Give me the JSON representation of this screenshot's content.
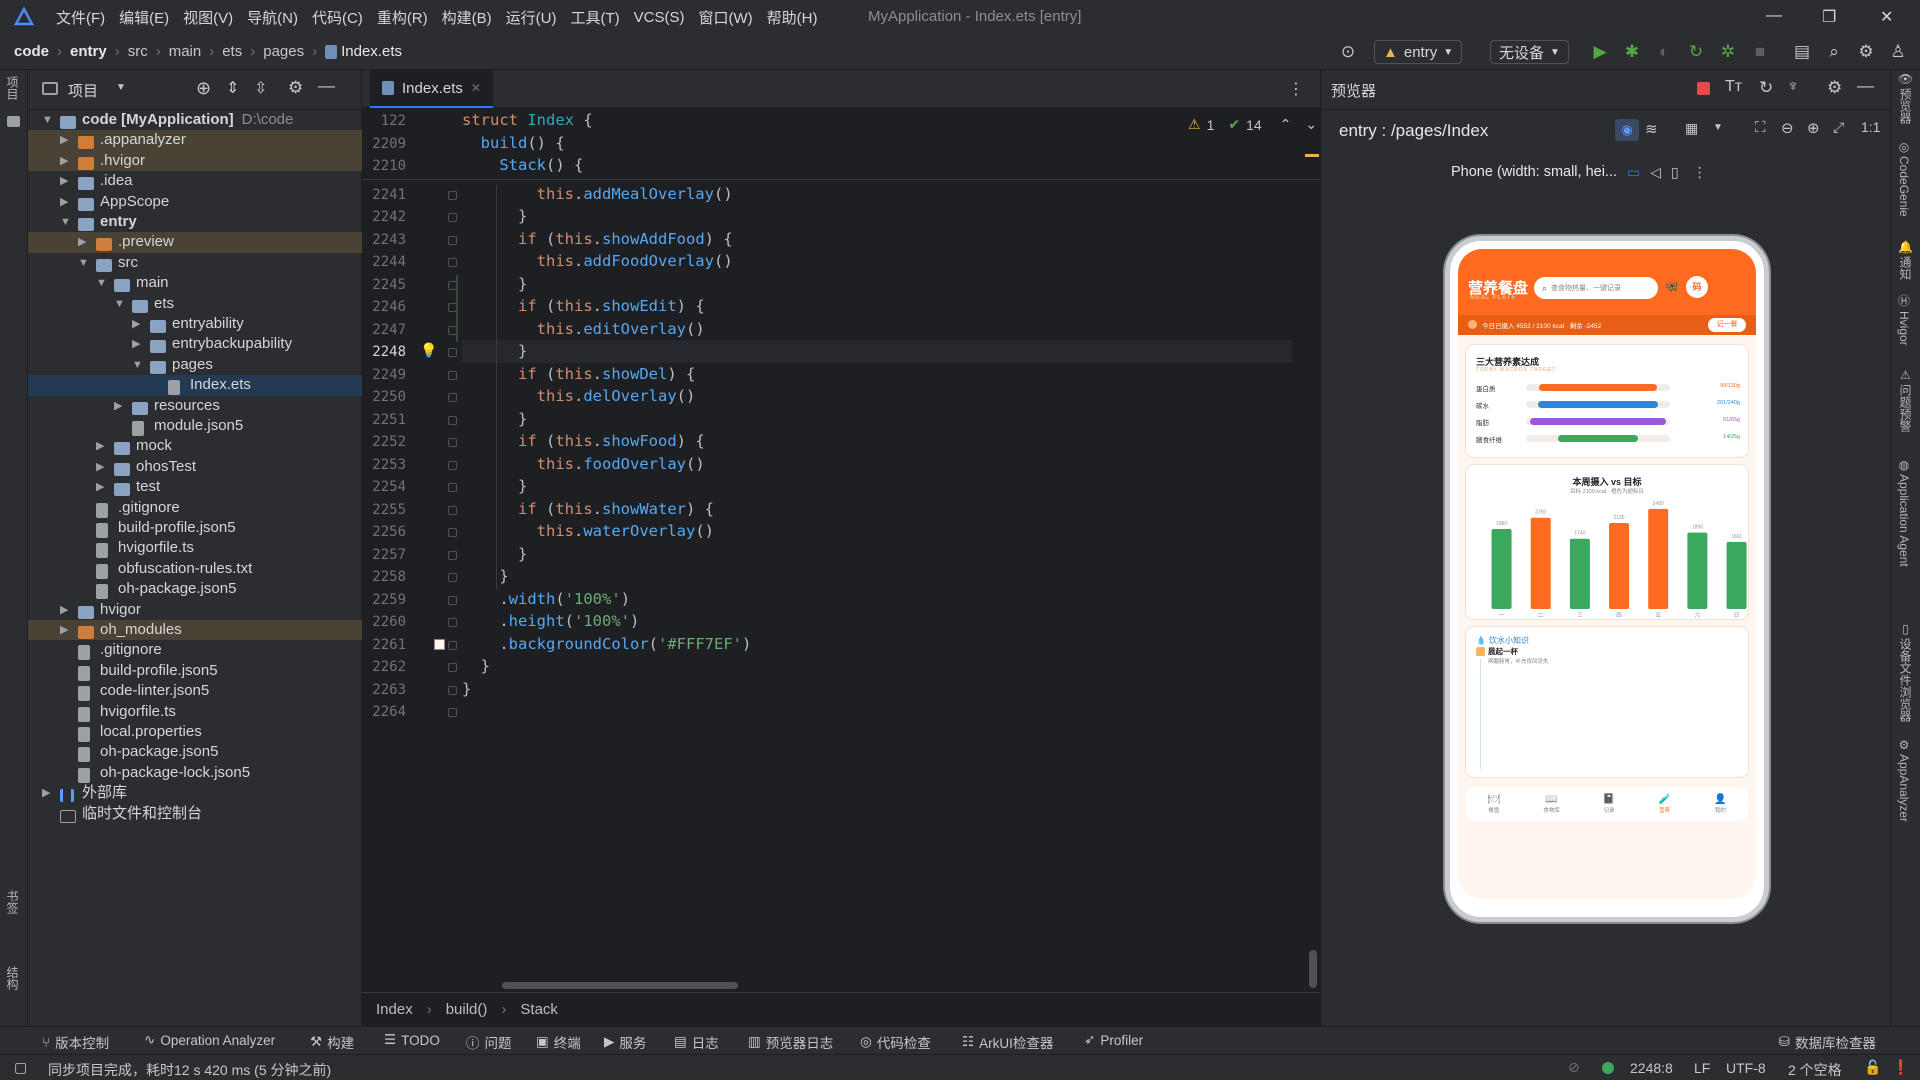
{
  "menubar": {
    "items": [
      "文件(F)",
      "编辑(E)",
      "视图(V)",
      "导航(N)",
      "代码(C)",
      "重构(R)",
      "构建(B)",
      "运行(U)",
      "工具(T)",
      "VCS(S)",
      "窗口(W)",
      "帮助(H)"
    ],
    "window_title": "MyApplication - Index.ets [entry]"
  },
  "navbar": {
    "breadcrumbs": [
      "code",
      "entry",
      "src",
      "main",
      "ets",
      "pages",
      "Index.ets"
    ],
    "run_config": "entry",
    "device": "无设备"
  },
  "left_stripe": {
    "top_label": "项目",
    "bottom_labels": [
      "书签",
      "结构"
    ]
  },
  "project": {
    "title": "项目",
    "tree": [
      {
        "label": "code [MyApplication]",
        "path": "D:\\code",
        "depth": 0,
        "arrow": "down",
        "kind": "folder"
      },
      {
        "label": ".appanalyzer",
        "depth": 1,
        "arrow": "right",
        "kind": "folder-o",
        "hl": true
      },
      {
        "label": ".hvigor",
        "depth": 1,
        "arrow": "right",
        "kind": "folder-o",
        "hl": true
      },
      {
        "label": ".idea",
        "depth": 1,
        "arrow": "right",
        "kind": "folder"
      },
      {
        "label": "AppScope",
        "depth": 1,
        "arrow": "right",
        "kind": "folder"
      },
      {
        "label": "entry",
        "depth": 1,
        "arrow": "down",
        "kind": "folder",
        "bold": true
      },
      {
        "label": ".preview",
        "depth": 2,
        "arrow": "right",
        "kind": "folder-o",
        "hl": true
      },
      {
        "label": "src",
        "depth": 2,
        "arrow": "down",
        "kind": "folder"
      },
      {
        "label": "main",
        "depth": 3,
        "arrow": "down",
        "kind": "folder"
      },
      {
        "label": "ets",
        "depth": 4,
        "arrow": "down",
        "kind": "folder"
      },
      {
        "label": "entryability",
        "depth": 5,
        "arrow": "right",
        "kind": "folder"
      },
      {
        "label": "entrybackupability",
        "depth": 5,
        "arrow": "right",
        "kind": "folder"
      },
      {
        "label": "pages",
        "depth": 5,
        "arrow": "down",
        "kind": "folder"
      },
      {
        "label": "Index.ets",
        "depth": 6,
        "arrow": "",
        "kind": "file",
        "sel": true
      },
      {
        "label": "resources",
        "depth": 4,
        "arrow": "right",
        "kind": "folder"
      },
      {
        "label": "module.json5",
        "depth": 4,
        "arrow": "",
        "kind": "file"
      },
      {
        "label": "mock",
        "depth": 3,
        "arrow": "right",
        "kind": "folder"
      },
      {
        "label": "ohosTest",
        "depth": 3,
        "arrow": "right",
        "kind": "folder"
      },
      {
        "label": "test",
        "depth": 3,
        "arrow": "right",
        "kind": "folder"
      },
      {
        "label": ".gitignore",
        "depth": 2,
        "arrow": "",
        "kind": "file"
      },
      {
        "label": "build-profile.json5",
        "depth": 2,
        "arrow": "",
        "kind": "file"
      },
      {
        "label": "hvigorfile.ts",
        "depth": 2,
        "arrow": "",
        "kind": "file"
      },
      {
        "label": "obfuscation-rules.txt",
        "depth": 2,
        "arrow": "",
        "kind": "file"
      },
      {
        "label": "oh-package.json5",
        "depth": 2,
        "arrow": "",
        "kind": "file"
      },
      {
        "label": "hvigor",
        "depth": 1,
        "arrow": "right",
        "kind": "folder"
      },
      {
        "label": "oh_modules",
        "depth": 1,
        "arrow": "right",
        "kind": "folder-o",
        "hl": true
      },
      {
        "label": ".gitignore",
        "depth": 1,
        "arrow": "",
        "kind": "file"
      },
      {
        "label": "build-profile.json5",
        "depth": 1,
        "arrow": "",
        "kind": "file"
      },
      {
        "label": "code-linter.json5",
        "depth": 1,
        "arrow": "",
        "kind": "file"
      },
      {
        "label": "hvigorfile.ts",
        "depth": 1,
        "arrow": "",
        "kind": "file"
      },
      {
        "label": "local.properties",
        "depth": 1,
        "arrow": "",
        "kind": "file"
      },
      {
        "label": "oh-package.json5",
        "depth": 1,
        "arrow": "",
        "kind": "file"
      },
      {
        "label": "oh-package-lock.json5",
        "depth": 1,
        "arrow": "",
        "kind": "file"
      },
      {
        "label": "外部库",
        "depth": 0,
        "arrow": "right",
        "kind": "lib"
      },
      {
        "label": "临时文件和控制台",
        "depth": 0,
        "arrow": "",
        "kind": "scratch"
      }
    ]
  },
  "editor": {
    "tab_label": "Index.ets",
    "warnings": "1",
    "checks": "14",
    "sticky": [
      {
        "ln": "122",
        "html": "<span class='kw'>struct</span> <span class='ty'>Index</span> {"
      },
      {
        "ln": "2209",
        "html": "  <span class='fn'>build</span>() {"
      },
      {
        "ln": "2210",
        "html": "    <span class='fn'>Stack</span>() {"
      }
    ],
    "lines": [
      {
        "ln": "2241",
        "html": "        <span class='th'>this</span>.<span class='fn'>addMealOverlay</span>()"
      },
      {
        "ln": "2242",
        "html": "      }"
      },
      {
        "ln": "2243",
        "html": "      <span class='kw'>if</span> (<span class='th'>this</span>.<span class='prop'>showAddFood</span>) {"
      },
      {
        "ln": "2244",
        "html": "        <span class='th'>this</span>.<span class='fn'>addFoodOverlay</span>()"
      },
      {
        "ln": "2245",
        "html": "      }"
      },
      {
        "ln": "2246",
        "html": "      <span class='kw'>if</span> (<span class='th'>this</span>.<span class='prop'>showEdit</span>) {"
      },
      {
        "ln": "2247",
        "html": "        <span class='th'>this</span>.<span class='fn'>editOverlay</span>()"
      },
      {
        "ln": "2248",
        "html": "      }"
      },
      {
        "ln": "2249",
        "html": "      <span class='kw'>if</span> (<span class='th'>this</span>.<span class='prop'>showDel</span>) {"
      },
      {
        "ln": "2250",
        "html": "        <span class='th'>this</span>.<span class='fn'>delOverlay</span>()"
      },
      {
        "ln": "2251",
        "html": "      }"
      },
      {
        "ln": "2252",
        "html": "      <span class='kw'>if</span> (<span class='th'>this</span>.<span class='prop'>showFood</span>) {"
      },
      {
        "ln": "2253",
        "html": "        <span class='th'>this</span>.<span class='fn'>foodOverlay</span>()"
      },
      {
        "ln": "2254",
        "html": "      }"
      },
      {
        "ln": "2255",
        "html": "      <span class='kw'>if</span> (<span class='th'>this</span>.<span class='prop'>showWater</span>) {"
      },
      {
        "ln": "2256",
        "html": "        <span class='th'>this</span>.<span class='fn'>waterOverlay</span>()"
      },
      {
        "ln": "2257",
        "html": "      }"
      },
      {
        "ln": "2258",
        "html": "    }"
      },
      {
        "ln": "2259",
        "html": "    .<span class='fn'>width</span>(<span class='str'>'100%'</span>)"
      },
      {
        "ln": "2260",
        "html": "    .<span class='fn'>height</span>(<span class='str'>'100%'</span>)"
      },
      {
        "ln": "2261",
        "html": "    .<span class='fn'>backgroundColor</span>(<span class='str'>'#FFF7EF'</span>)"
      },
      {
        "ln": "2262",
        "html": "  }"
      },
      {
        "ln": "2263",
        "html": "}"
      },
      {
        "ln": "2264",
        "html": ""
      }
    ],
    "current_line": "2248",
    "breadcrumb": [
      "Index",
      "build()",
      "Stack"
    ]
  },
  "previewer": {
    "title": "预览器",
    "route": "entry : /pages/Index",
    "device_label": "Phone (width: small, hei...",
    "app": {
      "title": "营养餐盘",
      "subtitle": "MEAL PLATE",
      "search_placeholder": "查食物热量、一键记录",
      "avatar_text": "码",
      "summary": "今日已摄入 4552 / 2100 kcal · 剩余 -2452",
      "summary_btn": "记一餐",
      "macros_title": "三大营养素达成",
      "macros_sub": "TODAY MACROS TARGET",
      "macros": [
        {
          "name": "蛋白质",
          "value": "99/120g",
          "color": "#fe6a1f",
          "ratio": 0.82
        },
        {
          "name": "碳水",
          "value": "201/240g",
          "color": "#2f86d7",
          "ratio": 0.84
        },
        {
          "name": "脂肪",
          "value": "61/65g",
          "color": "#9b59d6",
          "ratio": 0.94
        },
        {
          "name": "膳食纤维",
          "value": "14/25g",
          "color": "#3aa85d",
          "ratio": 0.56
        }
      ],
      "weekly_title": "本周摄入 vs 目标",
      "weekly_sub": "目标 2100 kcal · 橙色为超标日",
      "water_title": "饮水小知识",
      "water_item_title": "晨起一杯",
      "water_item_desc": "唤醒肠胃，补充夜间流失",
      "bottom_nav": [
        {
          "label": "餐盘",
          "icon": "🍽"
        },
        {
          "label": "食物库",
          "icon": "📖"
        },
        {
          "label": "记录",
          "icon": "📓"
        },
        {
          "label": "营养",
          "icon": "🧪",
          "active": true
        },
        {
          "label": "我的",
          "icon": "👤"
        }
      ]
    },
    "chart_data": {
      "type": "bar",
      "title": "本周摄入 vs 目标",
      "categories": [
        "一",
        "二",
        "三",
        "四",
        "五",
        "六",
        "日"
      ],
      "values": [
        1980,
        2260,
        1740,
        2130,
        2480,
        1890,
        1661
      ],
      "target": 2100,
      "over_color": "#fe6a1f",
      "under_color": "#3aa85d",
      "ylim": [
        0,
        2600
      ]
    }
  },
  "right_stripe": {
    "labels": [
      "预览器",
      "CodeGenie",
      "通知",
      "Hvigor",
      "问题预警",
      "Application Agent",
      "设备文件浏览器",
      "AppAnalyzer"
    ]
  },
  "bottombar": {
    "items": [
      "版本控制",
      "Operation Analyzer",
      "构建",
      "TODO",
      "问题",
      "终端",
      "服务",
      "日志",
      "预览器日志",
      "代码检查",
      "ArkUI检查器",
      "Profiler"
    ],
    "right_item": "数据库检查器"
  },
  "statusbar": {
    "message": "同步项目完成，耗时12 s 420 ms (5 分钟之前)",
    "position": "2248:8",
    "line_sep": "LF",
    "encoding": "UTF-8",
    "indent": "2 个空格"
  },
  "colors": {
    "accent": "#3574f0",
    "brand": "#fe6a1f",
    "app_bg": "#FFF7EF"
  }
}
